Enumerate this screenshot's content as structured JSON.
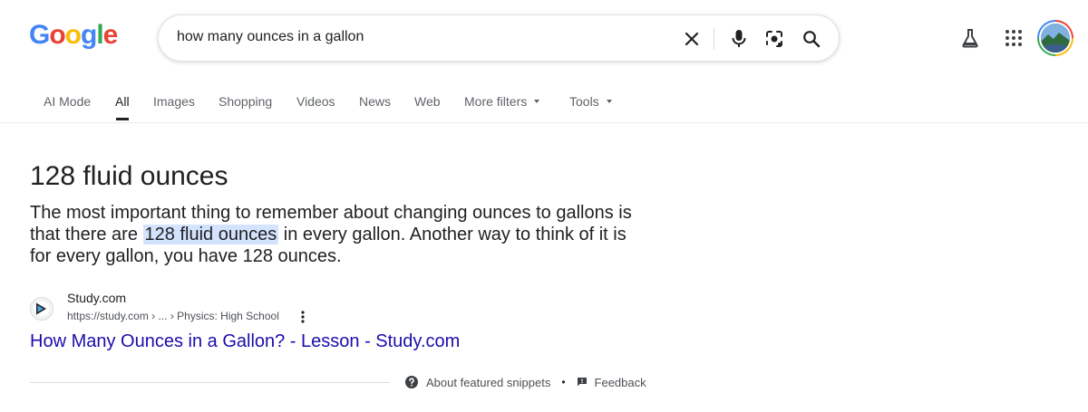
{
  "header": {
    "logo_letters": [
      {
        "ch": "G",
        "color": "#4285f4"
      },
      {
        "ch": "o",
        "color": "#ea4335"
      },
      {
        "ch": "o",
        "color": "#fbbc05"
      },
      {
        "ch": "g",
        "color": "#4285f4"
      },
      {
        "ch": "l",
        "color": "#34a853"
      },
      {
        "ch": "e",
        "color": "#ea4335"
      }
    ],
    "search_value": "how many ounces in a gallon",
    "icons": [
      "clear-icon",
      "microphone-icon",
      "lens-icon",
      "search-icon",
      "labs-flask-icon",
      "apps-grid-icon"
    ]
  },
  "tabs": [
    {
      "label": "AI Mode",
      "active": false
    },
    {
      "label": "All",
      "active": true
    },
    {
      "label": "Images",
      "active": false
    },
    {
      "label": "Shopping",
      "active": false
    },
    {
      "label": "Videos",
      "active": false
    },
    {
      "label": "News",
      "active": false
    },
    {
      "label": "Web",
      "active": false
    },
    {
      "label": "More filters",
      "active": false,
      "dropdown": true
    },
    {
      "label": "Tools",
      "active": false,
      "dropdown": true
    }
  ],
  "snippet": {
    "answer": "128 fluid ounces",
    "text_before": "The most important thing to remember about changing ounces to gallons is that there are ",
    "highlight": "128 fluid ounces",
    "text_after": " in every gallon. Another way to think of it is for every gallon, you have 128 ounces.",
    "source_name": "Study.com",
    "source_url": "https://study.com › ... › Physics: High School",
    "result_title": "How Many Ounces in a Gallon? - Lesson - Study.com"
  },
  "footer": {
    "about_label": "About featured snippets",
    "feedback_label": "Feedback",
    "separator": "•"
  },
  "colors": {
    "link": "#1a0dab",
    "highlight": "#d3e3fd",
    "accent_blue": "#4285f4"
  }
}
